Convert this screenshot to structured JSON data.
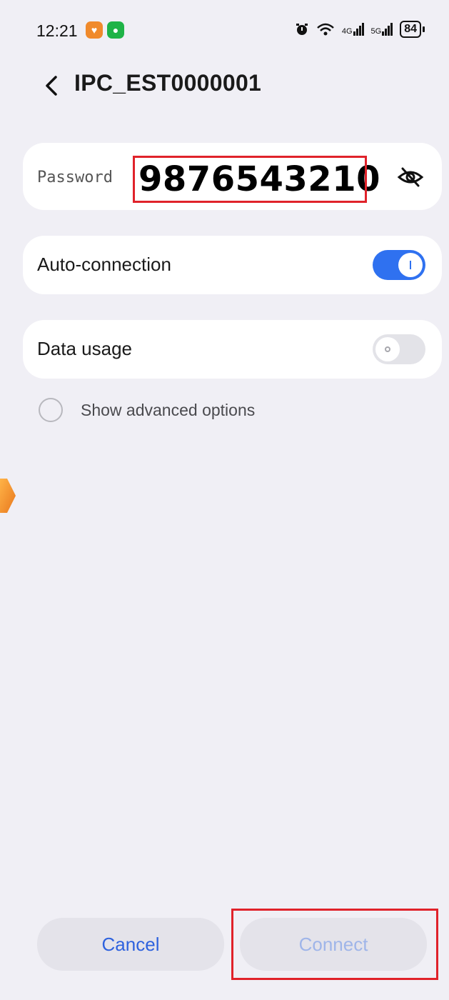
{
  "status_bar": {
    "time": "12:21",
    "network_4g": "4G",
    "network_5g": "5G",
    "battery": "84"
  },
  "header": {
    "title": "IPC_EST0000001"
  },
  "password": {
    "label": "Password",
    "value": "9876543210"
  },
  "auto_connection": {
    "label": "Auto-connection",
    "enabled": true
  },
  "data_usage": {
    "label": "Data usage",
    "enabled": false
  },
  "advanced": {
    "label": "Show advanced options",
    "checked": false
  },
  "buttons": {
    "cancel_label": "Cancel",
    "connect_label": "Connect"
  },
  "colors": {
    "accent": "#2f71f0",
    "highlight_box": "#e0222a",
    "background": "#f0eff5"
  },
  "icons": [
    "back-chevron-icon",
    "eye-off-icon",
    "alarm-icon",
    "wifi-icon",
    "signal-icon"
  ]
}
